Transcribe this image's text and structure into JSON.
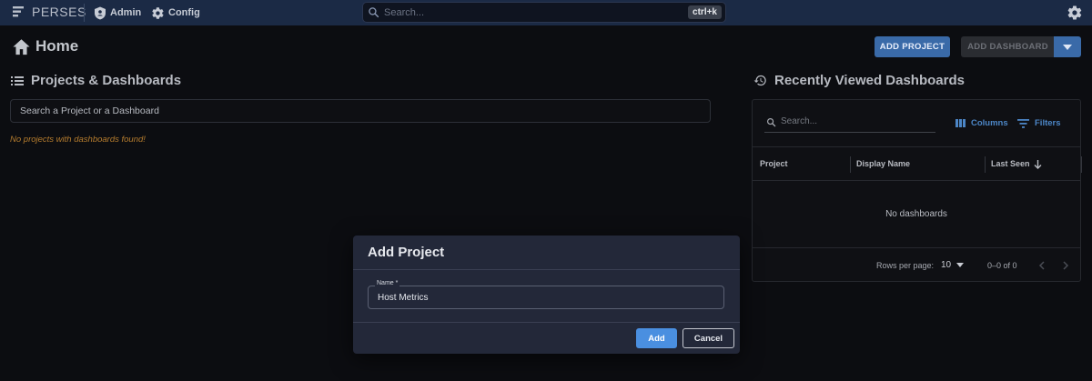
{
  "topbar": {
    "brand": "PERSES",
    "admin_label": "Admin",
    "config_label": "Config",
    "search_placeholder": "Search...",
    "search_shortcut": "ctrl+k"
  },
  "page": {
    "title": "Home",
    "add_project_label": "ADD PROJECT",
    "add_dashboard_label": "ADD DASHBOARD"
  },
  "projects": {
    "title": "Projects & Dashboards",
    "search_placeholder": "Search a Project or a Dashboard",
    "empty_message": "No projects with dashboards found!"
  },
  "recent": {
    "title": "Recently Viewed Dashboards",
    "search_placeholder": "Search...",
    "columns_label": "Columns",
    "filters_label": "Filters",
    "headers": [
      "Project",
      "Display Name",
      "Last Seen"
    ],
    "empty_message": "No dashboards",
    "rows_per_page_label": "Rows per page:",
    "rows_per_page_value": "10",
    "range_label": "0–0 of 0"
  },
  "dialog": {
    "title": "Add Project",
    "name_label": "Name *",
    "name_value": "Host Metrics",
    "add_label": "Add",
    "cancel_label": "Cancel"
  },
  "colors": {
    "topbar": "#1b2a45",
    "primary": "#3a6aa8",
    "accent_button": "#4a8fe0",
    "warning_text": "#b57c2e"
  }
}
